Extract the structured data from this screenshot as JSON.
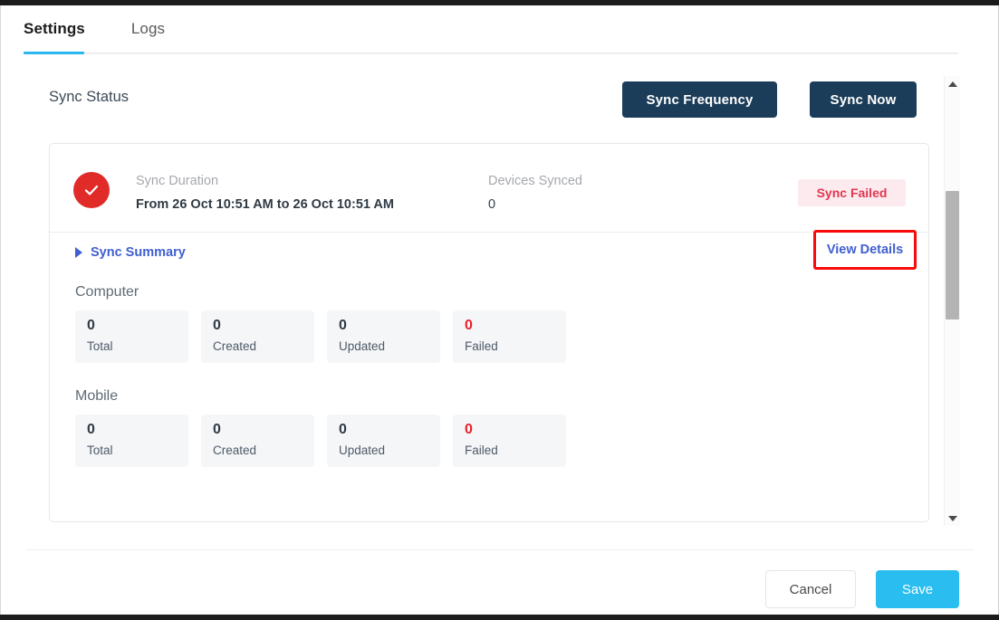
{
  "tabs": [
    {
      "label": "Settings",
      "active": true
    },
    {
      "label": "Logs",
      "active": false
    }
  ],
  "header": {
    "section_title": "Sync Status",
    "sync_frequency_button": "Sync Frequency",
    "sync_now_button": "Sync Now"
  },
  "status_card": {
    "icon": "check-circle-icon",
    "icon_color": "#e02b29",
    "duration_label": "Sync Duration",
    "duration_value": "From 26 Oct 10:51 AM to 26 Oct 10:51 AM",
    "devices_label": "Devices Synced",
    "devices_value": "0",
    "badge_text": "Sync Failed",
    "badge_bg": "#fdeaee",
    "badge_color": "#e0384f"
  },
  "summary": {
    "toggle_label": "Sync Summary",
    "toggle_color": "#3f5fd0",
    "view_details_label": "View Details",
    "highlight_color": "#fa0a0a",
    "groups": [
      {
        "title": "Computer",
        "stats": [
          {
            "value": "0",
            "label": "Total",
            "failed": false
          },
          {
            "value": "0",
            "label": "Created",
            "failed": false
          },
          {
            "value": "0",
            "label": "Updated",
            "failed": false
          },
          {
            "value": "0",
            "label": "Failed",
            "failed": true
          }
        ]
      },
      {
        "title": "Mobile",
        "stats": [
          {
            "value": "0",
            "label": "Total",
            "failed": false
          },
          {
            "value": "0",
            "label": "Created",
            "failed": false
          },
          {
            "value": "0",
            "label": "Updated",
            "failed": false
          },
          {
            "value": "0",
            "label": "Failed",
            "failed": true
          }
        ]
      }
    ]
  },
  "scrollbar": {
    "up_icon": "caret-up-icon",
    "down_icon": "caret-down-icon"
  },
  "footer": {
    "cancel_label": "Cancel",
    "save_label": "Save",
    "save_color": "#29bdf0"
  }
}
